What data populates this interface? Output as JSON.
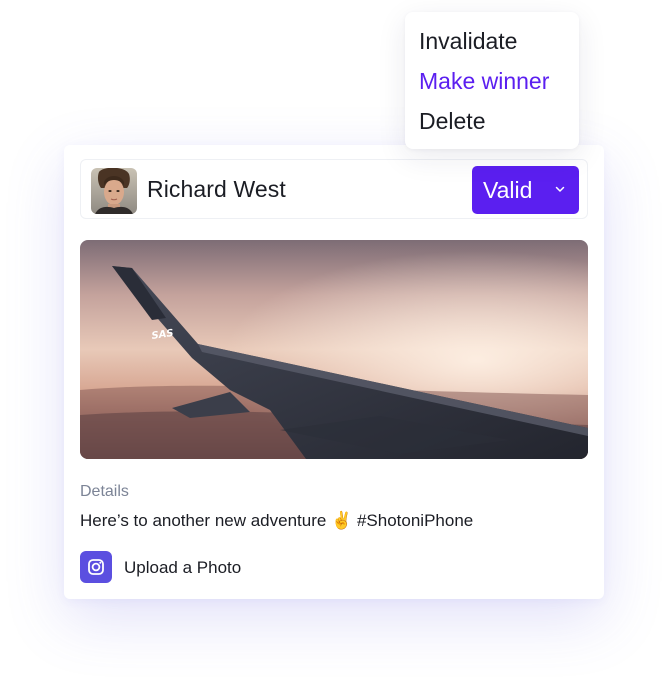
{
  "entry": {
    "user_name": "Richard West",
    "status": "Valid",
    "details_label": "Details",
    "caption": "Here’s to another new adventure ✌️ #ShotoniPhone",
    "upload_label": "Upload a Photo",
    "upload_icon": "instagram-icon",
    "photo_wing_text": "SAS"
  },
  "status_menu": {
    "items": [
      "Invalidate",
      "Make winner",
      "Delete"
    ],
    "highlighted": "Make winner"
  },
  "colors": {
    "accent": "#5b1ff0",
    "upload_icon_bg": "#5b4fe0",
    "text": "#1b1d24",
    "muted": "#7c8496"
  }
}
